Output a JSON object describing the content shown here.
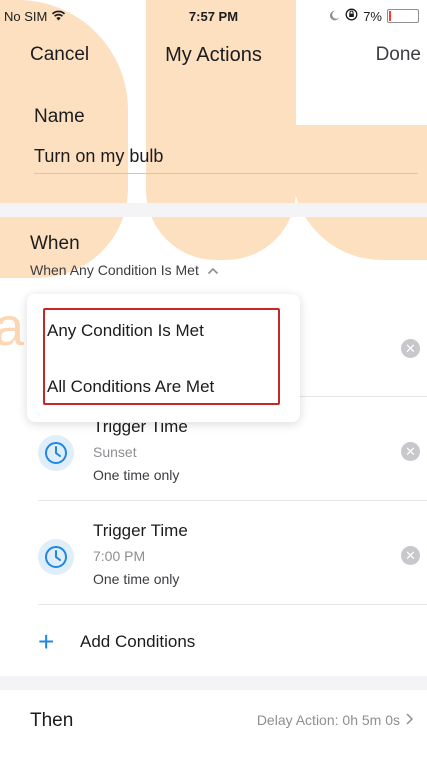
{
  "statusbar": {
    "carrier": "No SIM",
    "time": "7:57 PM",
    "battery": "7%"
  },
  "nav": {
    "cancel": "Cancel",
    "title": "My Actions",
    "done": "Done"
  },
  "name": {
    "label": "Name",
    "value": "Turn on my bulb"
  },
  "when": {
    "label": "When",
    "selected": "When Any Condition Is Met",
    "options": [
      "Any Condition Is Met",
      "All Conditions Are Met"
    ]
  },
  "conditions": [
    {
      "title": "Trigger Time",
      "time": "Sunset",
      "repeat": "One time only"
    },
    {
      "title": "Trigger Time",
      "time": "7:00 PM",
      "repeat": "One time only"
    }
  ],
  "add_conditions": "Add Conditions",
  "then": {
    "label": "Then",
    "delay": "Delay Action: 0h 5m 0s"
  },
  "watermark": "art",
  "colors": {
    "accent": "#1e88e5",
    "highlight": "#c62828",
    "watermark": "#fde0c0"
  },
  "icons": [
    "wifi-icon",
    "moon-icon",
    "rotation-lock-icon",
    "battery-icon",
    "chevron-up-icon",
    "remove-icon",
    "clock-icon",
    "plus-icon",
    "chevron-right-icon"
  ]
}
